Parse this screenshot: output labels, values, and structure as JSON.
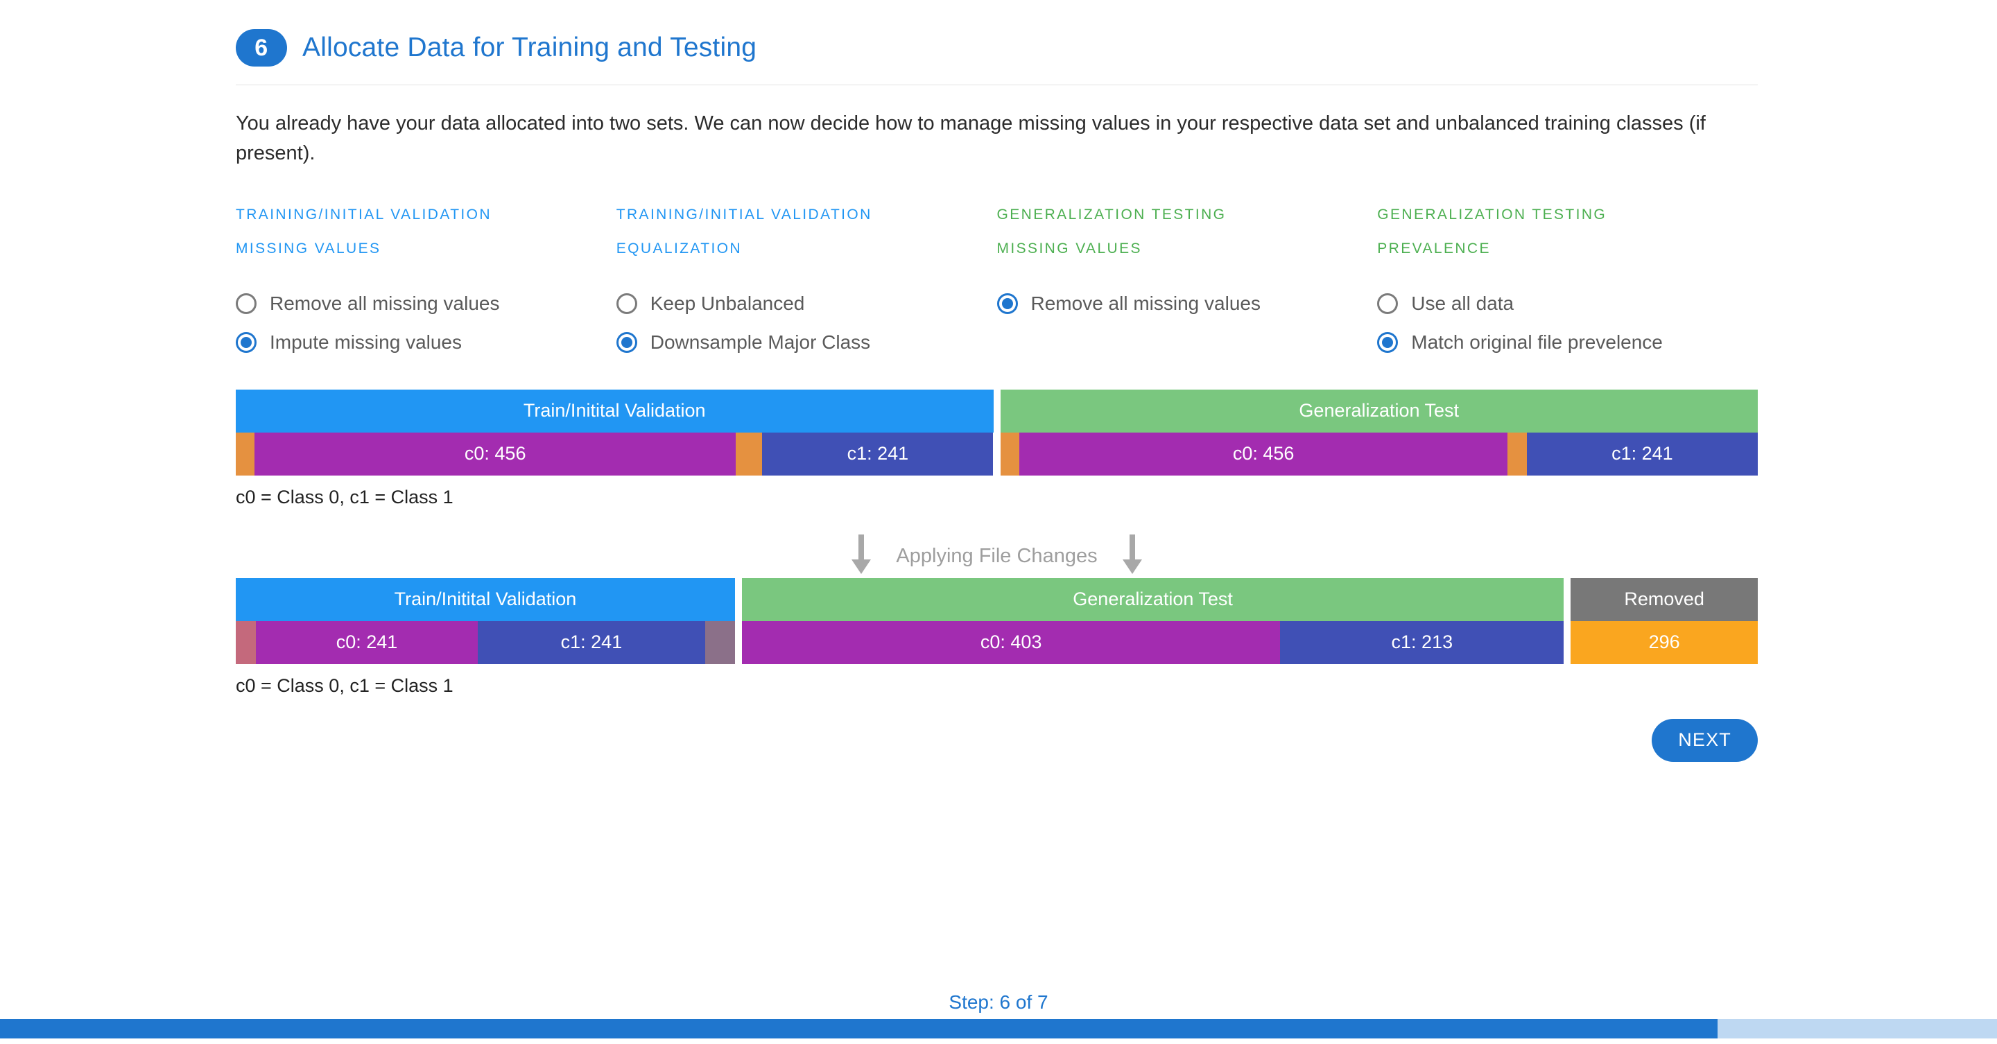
{
  "header": {
    "step_number": "6",
    "title": "Allocate Data for Training and Testing"
  },
  "intro": "You already have your data allocated into two sets. We can now decide how to manage missing values in your respective data set and unbalanced training classes (if present).",
  "option_columns": [
    {
      "heading_line1": "TRAINING/INITIAL VALIDATION",
      "heading_line2": "MISSING VALUES",
      "color": "#2196f3",
      "options": [
        {
          "label": "Remove all missing values",
          "selected": false
        },
        {
          "label": "Impute missing values",
          "selected": true
        }
      ]
    },
    {
      "heading_line1": "TRAINING/INITIAL VALIDATION",
      "heading_line2": "EQUALIZATION",
      "color": "#2196f3",
      "options": [
        {
          "label": "Keep Unbalanced",
          "selected": false
        },
        {
          "label": "Downsample Major Class",
          "selected": true
        }
      ]
    },
    {
      "heading_line1": "GENERALIZATION TESTING",
      "heading_line2": "MISSING VALUES",
      "color": "#4caf50",
      "options": [
        {
          "label": "Remove all missing values",
          "selected": true
        }
      ]
    },
    {
      "heading_line1": "GENERALIZATION TESTING",
      "heading_line2": "PREVALENCE",
      "color": "#4caf50",
      "options": [
        {
          "label": "Use all data",
          "selected": false
        },
        {
          "label": "Match original file prevelence",
          "selected": true
        }
      ]
    }
  ],
  "chart_data": {
    "type": "bar",
    "title": "Data allocation before and after applying file changes",
    "legend_note": "c0 = Class 0, c1 = Class 1",
    "rows": [
      {
        "name": "before",
        "groups": [
          {
            "title": "Train/Initital Validation",
            "title_color": "#2196f3",
            "width_pct": 50,
            "segments": [
              {
                "label": "",
                "value": null,
                "color": "#e59140",
                "width_pct": 2.5
              },
              {
                "label": "c0: 456",
                "value": 456,
                "color": "#a32cb0",
                "width_pct": 63.5
              },
              {
                "label": "",
                "value": null,
                "color": "#e59140",
                "width_pct": 3.5
              },
              {
                "label": "c1: 241",
                "value": 241,
                "color": "#4050b5",
                "width_pct": 30.5
              }
            ]
          },
          {
            "title": "Generalization Test",
            "title_color": "#7ac77f",
            "width_pct": 50,
            "segments": [
              {
                "label": "",
                "value": null,
                "color": "#e59140",
                "width_pct": 2.5
              },
              {
                "label": "c0: 456",
                "value": 456,
                "color": "#a32cb0",
                "width_pct": 64.5
              },
              {
                "label": "",
                "value": null,
                "color": "#e59140",
                "width_pct": 2.5
              },
              {
                "label": "c1: 241",
                "value": 241,
                "color": "#4050b5",
                "width_pct": 30.5
              }
            ]
          }
        ]
      },
      {
        "name": "after",
        "groups": [
          {
            "title": "Train/Initital Validation",
            "title_color": "#2196f3",
            "width_pct": 33.1,
            "segments": [
              {
                "label": "",
                "value": null,
                "color": "#c4697c",
                "width_pct": 4.0
              },
              {
                "label": "c0: 241",
                "value": 241,
                "color": "#a32cb0",
                "width_pct": 44.5
              },
              {
                "label": "c1: 241",
                "value": 241,
                "color": "#4050b5",
                "width_pct": 45.5
              },
              {
                "label": "",
                "value": null,
                "color": "#8b7089",
                "width_pct": 6.0
              }
            ]
          },
          {
            "title": "Generalization Test",
            "title_color": "#7ac77f",
            "width_pct": 54.5,
            "segments": [
              {
                "label": "c0: 403",
                "value": 403,
                "color": "#a32cb0",
                "width_pct": 65.5
              },
              {
                "label": "c1: 213",
                "value": 213,
                "color": "#4050b5",
                "width_pct": 34.5
              }
            ]
          },
          {
            "title": "Removed",
            "title_color": "#787878",
            "width_pct": 12.4,
            "segments": [
              {
                "label": "296",
                "value": 296,
                "color": "#faa61f",
                "width_pct": 100
              }
            ]
          }
        ]
      }
    ]
  },
  "applying": {
    "text": "Applying File Changes"
  },
  "actions": {
    "next_label": "NEXT"
  },
  "footer": {
    "step_text": "Step: 6 of 7",
    "progress_pct": 86
  }
}
